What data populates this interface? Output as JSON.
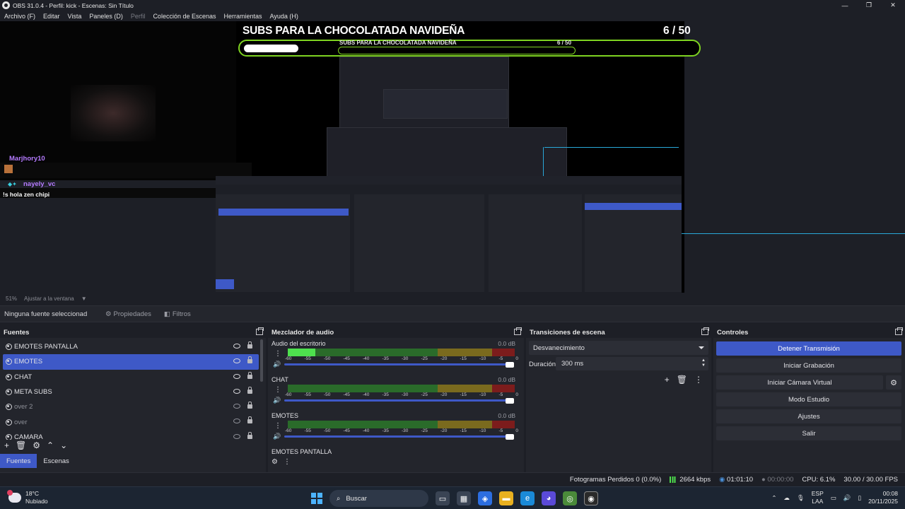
{
  "window": {
    "title": "OBS 31.0.4 - Perfil: kick - Escenas: Sin Título",
    "minimize": "—",
    "maximize": "❐",
    "close": "✕"
  },
  "menu": [
    "Archivo (F)",
    "Editar",
    "Vista",
    "Paneles (D)",
    "Perfil",
    "Colección de Escenas",
    "Herramientas",
    "Ayuda (H)"
  ],
  "preview": {
    "goal_title": "SUBS PARA LA CHOCOLATADA NAVIDEÑA",
    "goal_count": "6 / 50",
    "goal_progress": 0.12,
    "chat": [
      {
        "user": "Marjhory10",
        "message": ""
      },
      {
        "user": "nayely_vc",
        "message": "!s hola zen chipi"
      }
    ]
  },
  "zoom": {
    "percent": "51%",
    "fit_label": "Ajustar a la ventana"
  },
  "source_toolbar": {
    "no_selection": "Ninguna fuente seleccionad",
    "properties": "Propiedades",
    "filters": "Filtros"
  },
  "sources": {
    "title": "Fuentes",
    "items": [
      {
        "name": "EMOTES PANTALLA",
        "visible": true,
        "selected": false
      },
      {
        "name": "EMOTES",
        "visible": true,
        "selected": true
      },
      {
        "name": "CHAT",
        "visible": true,
        "selected": false
      },
      {
        "name": "META SUBS",
        "visible": true,
        "selected": false
      },
      {
        "name": "over 2",
        "visible": false,
        "selected": false
      },
      {
        "name": "over",
        "visible": false,
        "selected": false
      },
      {
        "name": "CAMARA",
        "visible": false,
        "selected": false
      }
    ],
    "tabs": [
      "Fuentes",
      "Escenas"
    ]
  },
  "mixer": {
    "title": "Mezclador de audio",
    "ticks": [
      "-60",
      "-55",
      "-50",
      "-45",
      "-40",
      "-35",
      "-30",
      "-25",
      "-20",
      "-15",
      "-10",
      "-5",
      "0"
    ],
    "channels": [
      {
        "name": "Audio del escritorio",
        "db": "0.0 dB",
        "level": 0.12
      },
      {
        "name": "CHAT",
        "db": "0.0 dB",
        "level": 0
      },
      {
        "name": "EMOTES",
        "db": "0.0 dB",
        "level": 0
      }
    ],
    "partial_channel": "EMOTES PANTALLA"
  },
  "transitions": {
    "title": "Transiciones de escena",
    "selected": "Desvanecimiento",
    "duration_label": "Duración",
    "duration_value": "300 ms"
  },
  "controls": {
    "title": "Controles",
    "buttons": [
      "Detener Transmisión",
      "Iniciar Grabación",
      "Iniciar Cámara Virtual",
      "Modo Estudio",
      "Ajustes",
      "Salir"
    ]
  },
  "status": {
    "dropped": "Fotogramas Perdidos 0 (0.0%)",
    "bitrate": "2664 kbps",
    "stream_time": "01:01:10",
    "rec_time": "00:00:00",
    "cpu": "CPU: 6.1%",
    "fps": "30.00 / 30.00 FPS"
  },
  "taskbar": {
    "temp": "18°C",
    "weather": "Nubiado",
    "search": "Buscar",
    "lang": "ESP",
    "lang2": "LAA",
    "time": "00:08",
    "date": "20/11/2025"
  },
  "colors": {
    "accent": "#3e59c7",
    "goal_border": "#7ed321",
    "bg": "#1d1f26",
    "panel": "#23252c"
  }
}
